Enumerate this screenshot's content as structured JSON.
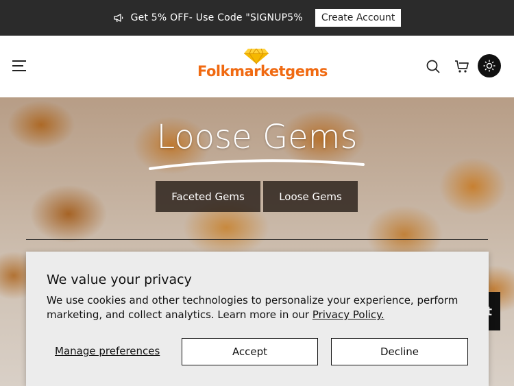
{
  "announcement": {
    "promo_text": "Get 5% OFF- Use Code \"SIGNUP5%",
    "create_account_label": "Create Account"
  },
  "header": {
    "logo_text": "Folkmarketgems",
    "icons": [
      "menu-icon",
      "search-icon",
      "cart-icon",
      "sun-icon"
    ]
  },
  "hero": {
    "title": "Loose Gems",
    "buttons": [
      {
        "label": "Faceted Gems"
      },
      {
        "label": "Loose Gems"
      }
    ]
  },
  "privacy": {
    "title": "We value your privacy",
    "body": "We use cookies and other technologies to personalize your experience, perform marketing, and collect analytics. Learn more in our",
    "policy_link": "Privacy Policy.",
    "manage_label": "Manage preferences",
    "accept_label": "Accept",
    "decline_label": "Decline"
  },
  "chat": {
    "partial_label": "t"
  },
  "colors": {
    "announce_bg": "#2b2b2b",
    "logo_orange": "#f06a12",
    "logo_gem": "#f5b800",
    "modal_bg": "#ececec"
  }
}
